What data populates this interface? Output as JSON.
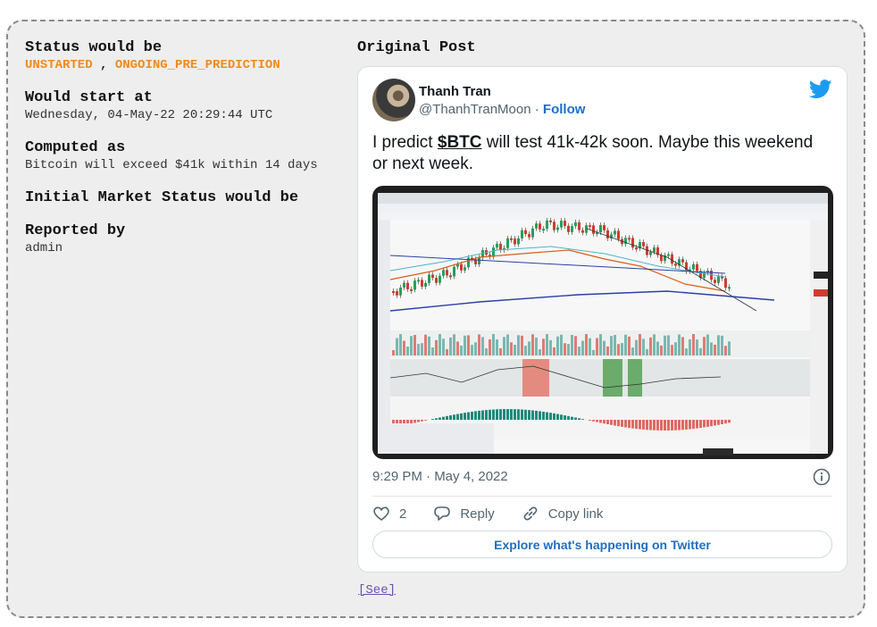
{
  "fields": {
    "status_label": "Status would be",
    "status_1": "UNSTARTED",
    "status_sep": " , ",
    "status_2": "ONGOING_PRE_PREDICTION",
    "start_label": "Would start at",
    "start_value": "Wednesday, 04-May-22 20:29:44 UTC",
    "computed_label": "Computed as",
    "computed_value": "Bitcoin will exceed $41k within 14 days",
    "initial_label": "Initial Market Status would be",
    "reported_label": "Reported by",
    "reported_value": "admin"
  },
  "post_section_title": "Original Post",
  "tweet": {
    "author_name": "Thanh Tran",
    "handle": "@ThanhTranMoon",
    "sep": " · ",
    "follow": "Follow",
    "text_before": "I predict ",
    "cashtag": "$BTC",
    "text_after": " will test 41k-42k soon. Maybe this weekend or next week.",
    "timestamp": "9:29 PM · May 4, 2022",
    "likes": "2",
    "reply_label": "Reply",
    "copy_label": "Copy link",
    "explore_label": "Explore what's happening on Twitter",
    "icons": [
      "twitter-bird-icon",
      "info-icon",
      "heart-icon",
      "reply-icon",
      "link-icon"
    ]
  },
  "see_link": "[See]",
  "colors": {
    "status": "#f08a1c",
    "link": "#1d6fc4",
    "twitter_blue": "#1d9bf0"
  }
}
